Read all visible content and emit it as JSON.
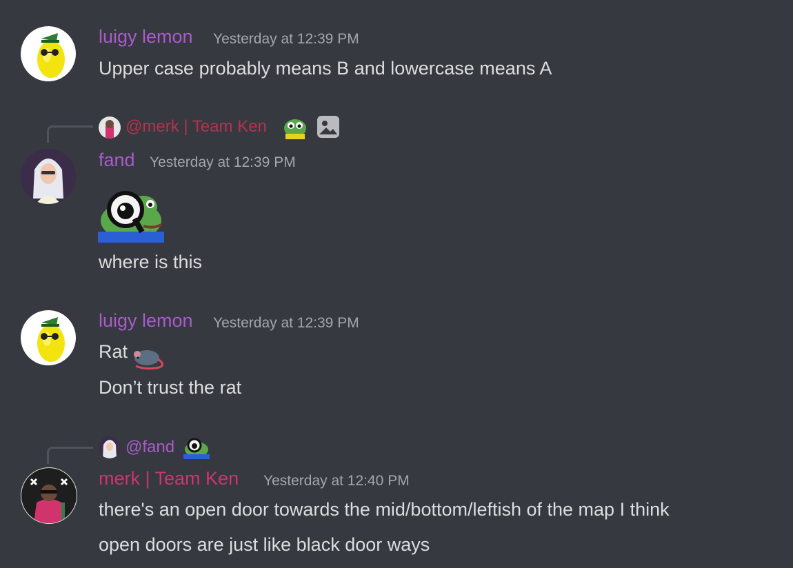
{
  "colors": {
    "background": "#36393f",
    "luigy": "#a95ccc",
    "fand": "#a95ccc",
    "merk": "#d1336d",
    "reply_luigy": "#a95ccc",
    "reply_merk": "#b8314f",
    "timestamp": "#a3a6aa",
    "text": "#dcddde"
  },
  "messages": [
    {
      "author": "luigy lemon",
      "timestamp": "Yesterday at 12:39 PM",
      "lines": [
        "Upper case probably means B and lowercase means A"
      ],
      "avatar_icon": "lemon-avatar-icon"
    },
    {
      "reply_to": "@merk | Team Ken",
      "author": "fand",
      "timestamp": "Yesterday at 12:39 PM",
      "sticker_icon": "pepe-magnifier-emoji",
      "lines": [
        "where is this"
      ],
      "avatar_icon": "girl-avatar-icon"
    },
    {
      "author": "luigy lemon",
      "timestamp": "Yesterday at 12:39 PM",
      "lines": [
        "Rat",
        "Don’t trust the rat"
      ],
      "rat_emoji": "rat-emoji",
      "avatar_icon": "lemon-avatar-icon"
    },
    {
      "reply_to": "@fand",
      "author": "merk | Team Ken",
      "timestamp": "Yesterday at 12:40 PM",
      "lines": [
        "there's an open door towards the mid/bottom/leftish of the map I think",
        "open doors are just like black door ways"
      ],
      "avatar_icon": "merk-avatar-icon"
    }
  ]
}
